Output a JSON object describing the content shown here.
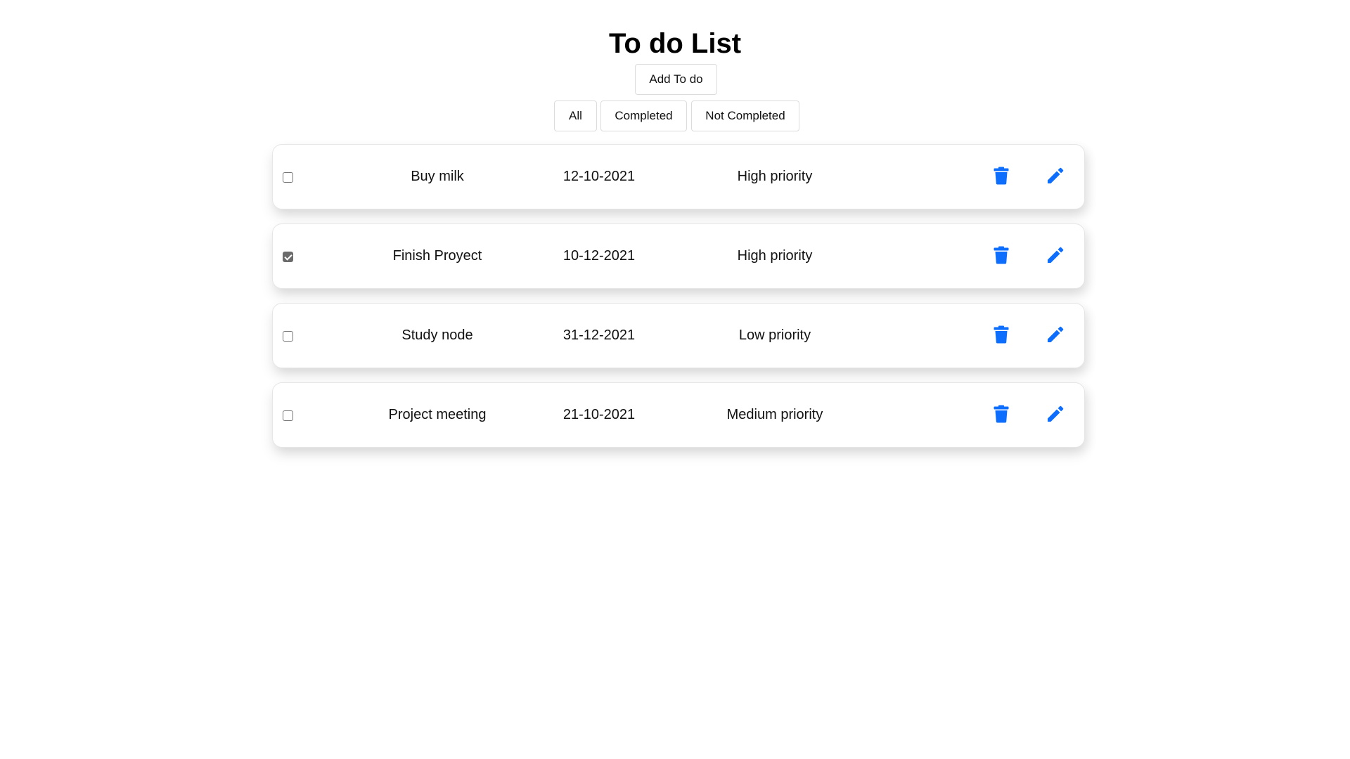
{
  "header": {
    "title": "To do List",
    "add_label": "Add To do"
  },
  "filters": [
    {
      "label": "All"
    },
    {
      "label": "Completed"
    },
    {
      "label": "Not Completed"
    }
  ],
  "todos": [
    {
      "name": "Buy milk",
      "date": "12-10-2021",
      "priority": "High priority",
      "completed": false
    },
    {
      "name": "Finish Proyect",
      "date": "10-12-2021",
      "priority": "High priority",
      "completed": true
    },
    {
      "name": "Study node",
      "date": "31-12-2021",
      "priority": "Low priority",
      "completed": false
    },
    {
      "name": "Project meeting",
      "date": "21-10-2021",
      "priority": "Medium priority",
      "completed": false
    }
  ],
  "icons": {
    "delete": "trash-icon",
    "edit": "pencil-icon",
    "accent": "#0d6efd"
  }
}
